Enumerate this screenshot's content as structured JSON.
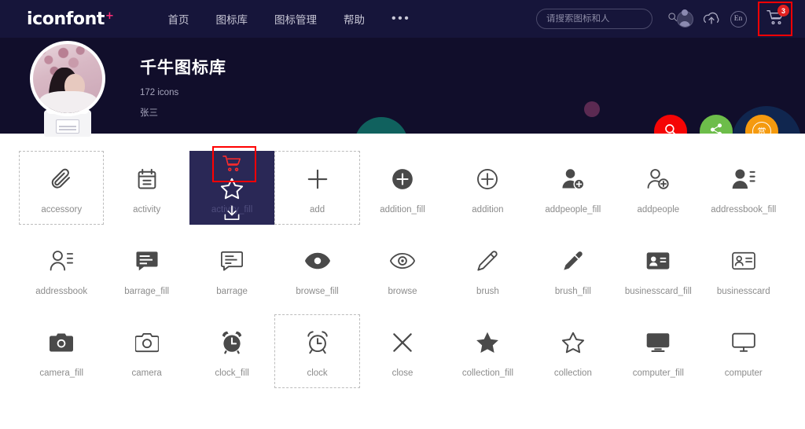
{
  "header": {
    "brand": "iconfont",
    "brand_plus": "+",
    "nav": [
      {
        "label": "首页",
        "name": "nav-home"
      },
      {
        "label": "图标库",
        "name": "nav-icon-library"
      },
      {
        "label": "图标管理",
        "name": "nav-icon-manage"
      },
      {
        "label": "帮助",
        "name": "nav-help"
      }
    ],
    "more_dots": "•••",
    "search": {
      "placeholder": "请搜索图标和人",
      "value": ""
    },
    "icons": [
      {
        "name": "user-avatar-icon"
      },
      {
        "name": "cloud-upload-icon"
      },
      {
        "name": "language-en-icon",
        "label": "En"
      },
      {
        "name": "cart-icon"
      }
    ],
    "language_label": "En",
    "cart_badge": "3"
  },
  "banner": {
    "title": "千牛图标库",
    "icon_count": "172 icons",
    "author": "张三",
    "fabs": [
      {
        "name": "fab-search",
        "icon": "search-icon"
      },
      {
        "name": "fab-share",
        "icon": "share-icon"
      },
      {
        "name": "fab-reward",
        "icon": "reward-icon",
        "label": "赏"
      }
    ],
    "reward_label": "赏"
  },
  "grid": {
    "items": [
      {
        "label": "accessory",
        "icon": "paperclip-icon",
        "state": "dashed"
      },
      {
        "label": "activity",
        "icon": "calendar-icon",
        "state": "normal"
      },
      {
        "label": "activity_fill",
        "icon": "calendar-fill-icon",
        "state": "hovered"
      },
      {
        "label": "add",
        "icon": "plus-icon",
        "state": "dashed"
      },
      {
        "label": "addition_fill",
        "icon": "plus-circle-fill-icon",
        "state": "normal"
      },
      {
        "label": "addition",
        "icon": "plus-circle-icon",
        "state": "normal"
      },
      {
        "label": "addpeople_fill",
        "icon": "user-add-fill-icon",
        "state": "normal"
      },
      {
        "label": "addpeople",
        "icon": "user-add-icon",
        "state": "normal"
      },
      {
        "label": "addressbook_fill",
        "icon": "addressbook-fill-icon",
        "state": "normal"
      },
      {
        "label": "addressbook",
        "icon": "addressbook-icon",
        "state": "normal"
      },
      {
        "label": "barrage_fill",
        "icon": "barrage-fill-icon",
        "state": "normal"
      },
      {
        "label": "barrage",
        "icon": "barrage-icon",
        "state": "normal"
      },
      {
        "label": "browse_fill",
        "icon": "eye-fill-icon",
        "state": "normal"
      },
      {
        "label": "browse",
        "icon": "eye-icon",
        "state": "normal"
      },
      {
        "label": "brush",
        "icon": "pencil-icon",
        "state": "normal"
      },
      {
        "label": "brush_fill",
        "icon": "pencil-fill-icon",
        "state": "normal"
      },
      {
        "label": "businesscard_fill",
        "icon": "businesscard-fill-icon",
        "state": "normal"
      },
      {
        "label": "businesscard",
        "icon": "businesscard-icon",
        "state": "normal"
      },
      {
        "label": "camera_fill",
        "icon": "camera-fill-icon",
        "state": "normal"
      },
      {
        "label": "camera",
        "icon": "camera-icon",
        "state": "normal"
      },
      {
        "label": "clock_fill",
        "icon": "alarm-fill-icon",
        "state": "normal"
      },
      {
        "label": "clock",
        "icon": "alarm-icon",
        "state": "dashed"
      },
      {
        "label": "close",
        "icon": "close-x-icon",
        "state": "normal"
      },
      {
        "label": "collection_fill",
        "icon": "star-fill-icon",
        "state": "normal"
      },
      {
        "label": "collection",
        "icon": "star-icon",
        "state": "normal"
      },
      {
        "label": "computer_fill",
        "icon": "monitor-fill-icon",
        "state": "normal"
      },
      {
        "label": "computer",
        "icon": "monitor-icon",
        "state": "normal"
      }
    ],
    "overlay_actions": [
      {
        "name": "add-to-cart-action",
        "icon": "cart-icon",
        "active": true
      },
      {
        "name": "favorite-action",
        "icon": "star-icon",
        "active": false
      },
      {
        "name": "download-action",
        "icon": "download-icon",
        "active": false
      }
    ]
  },
  "colors": {
    "header_bg": "#16153a",
    "banner_bg": "#110e2b",
    "accent_pink": "#ff2d78",
    "highlight_red": "#ff0000",
    "fab_search": "#f50505",
    "fab_share": "#6dbd4a",
    "fab_reward": "#f59a0e",
    "hover_card": "#2a2856"
  }
}
